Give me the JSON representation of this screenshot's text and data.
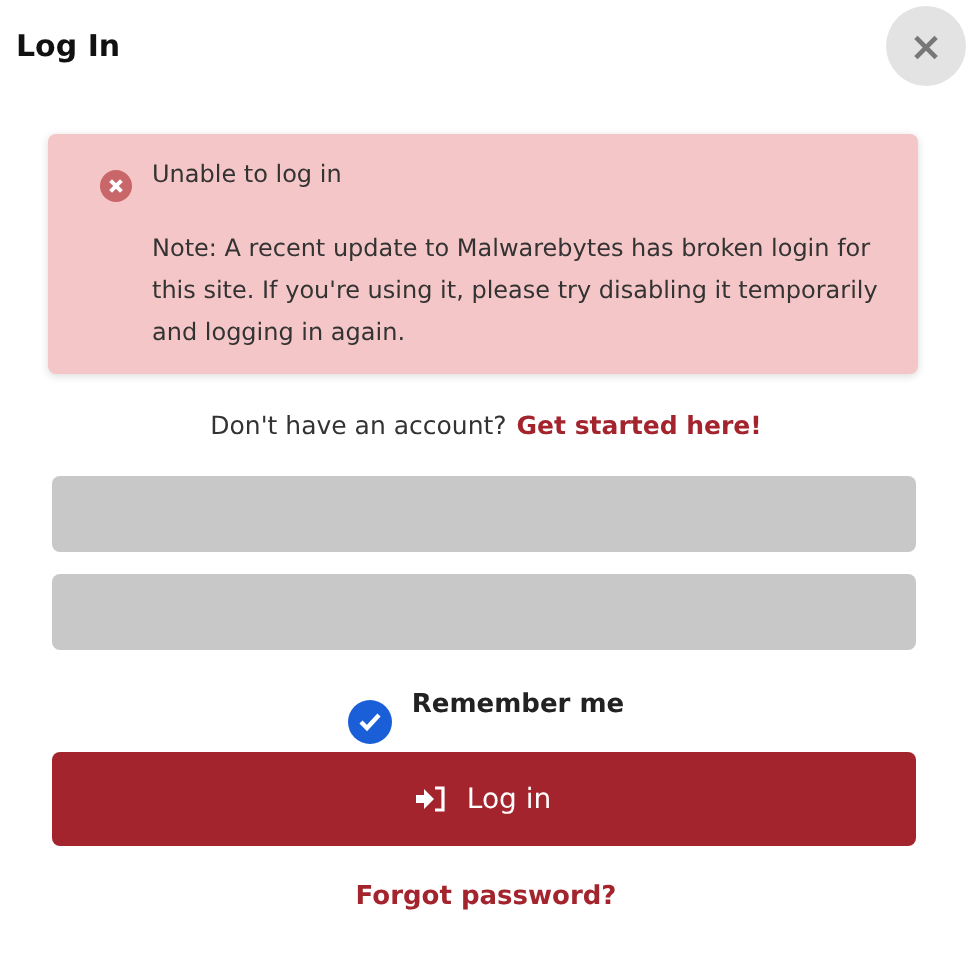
{
  "dialog": {
    "title": "Log In",
    "close_label": "×"
  },
  "alert": {
    "title": "Unable to log in",
    "message": "Note: A recent update to Malwarebytes has broken login for this site. If you're using it, please try disabling it temporarily and logging in again."
  },
  "signup": {
    "prompt": "Don't have an account?",
    "link": "Get started here!"
  },
  "remember": {
    "label": "Remember me",
    "checked": true
  },
  "login_button": {
    "label": "Log in"
  },
  "forgot_link": "Forgot password?"
}
